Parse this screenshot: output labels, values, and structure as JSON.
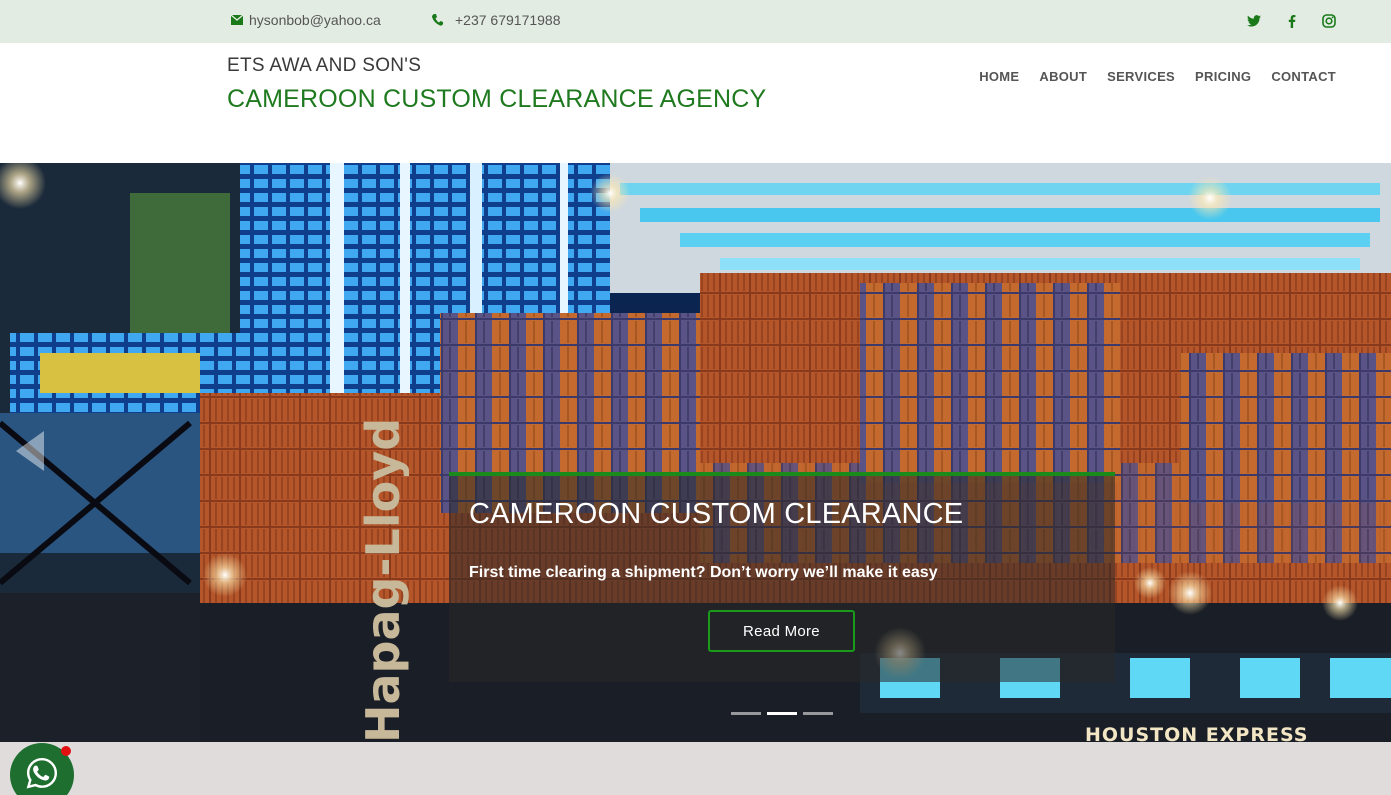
{
  "topbar": {
    "email": "hysonbob@yahoo.ca",
    "phone": "+237 679171988",
    "social": [
      "twitter-icon",
      "facebook-icon",
      "instagram-icon"
    ],
    "accent": "#1a7a1a"
  },
  "header": {
    "brand_small": "ETS AWA AND SON'S",
    "brand_big": "CAMEROON CUSTOM CLEARANCE AGENCY",
    "nav": [
      "HOME",
      "ABOUT",
      "SERVICES",
      "PRICING",
      "CONTACT"
    ]
  },
  "hero": {
    "title": "CAMEROON CUSTOM CLEARANCE",
    "subtitle": "First time clearing a shipment? Don’t worry we’ll make it easy",
    "button": "Read More",
    "slides": 3,
    "active_slide": 2,
    "ship_text": "HOUSTON  EXPRESS",
    "hull_text": "Hapag-Lloyd"
  }
}
